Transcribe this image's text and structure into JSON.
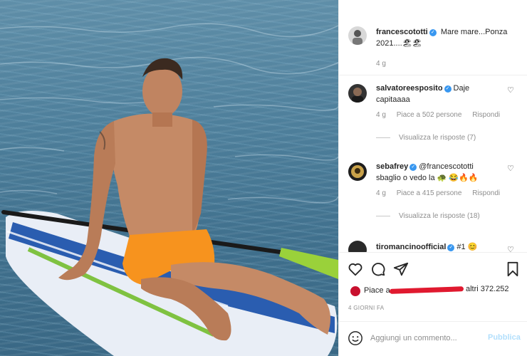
{
  "post": {
    "username": "francescototti",
    "caption_line1": "Mare mare...Ponza",
    "caption_line2": "2021....",
    "caption_emoji": "🏖🏖",
    "time": "4 g"
  },
  "comments": [
    {
      "username": "salvatoreesposito",
      "text_line1": "Daje",
      "text_line2": "capitaaaa",
      "time": "4 g",
      "likes": "Piace a 502 persone",
      "reply": "Rispondi",
      "view_replies": "Visualizza le risposte (7)"
    },
    {
      "username": "sebafrey",
      "text_line1": "@francescototti",
      "text_line2": "sbaglio o vedo la 🐢 😂🔥🔥",
      "time": "4 g",
      "likes": "Piace a 415 persone",
      "reply": "Rispondi",
      "view_replies": "Visualizza le risposte (18)"
    },
    {
      "username": "tiromancinoofficial",
      "text_line1": "#1 😊"
    }
  ],
  "likes": {
    "prefix": "Piace a",
    "suffix": "altri 372.252"
  },
  "date": "4 GIORNI FA",
  "composer": {
    "placeholder": "Aggiungi un commento...",
    "publish": "Pubblica"
  },
  "colors": {
    "verified": "#3897f0",
    "publish": "#b2dffc",
    "shorts": "#f7931e",
    "board": "#e9eef6"
  },
  "icons": [
    "heart-icon",
    "comment-icon",
    "share-icon",
    "bookmark-icon",
    "smile-icon",
    "verified-icon"
  ]
}
